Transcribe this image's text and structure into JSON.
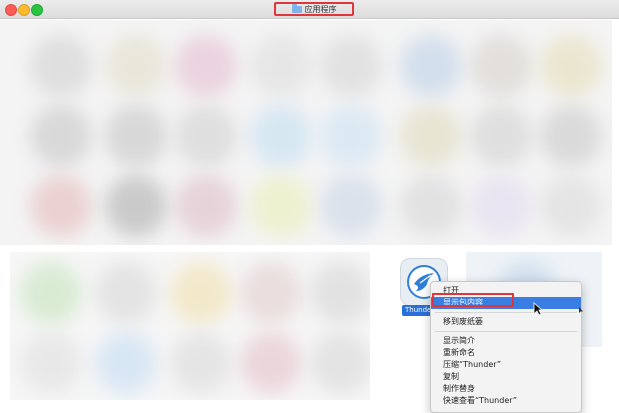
{
  "window": {
    "title": "应用程序"
  },
  "app": {
    "label": "Thunder",
    "icon": "thunder-bird-icon"
  },
  "context_menu": {
    "items": [
      {
        "label": "打开"
      },
      {
        "label": "显示包内容",
        "selected": true
      },
      {
        "label": "移到废纸篓"
      },
      {
        "label": "显示简介"
      },
      {
        "label": "重新命名"
      },
      {
        "label": "压缩“Thunder”"
      },
      {
        "label": "复制"
      },
      {
        "label": "制作替身"
      },
      {
        "label": "快速查看“Thunder”"
      }
    ]
  },
  "colors": {
    "highlight": "#3b7ee3",
    "annotation": "#e0353b"
  }
}
